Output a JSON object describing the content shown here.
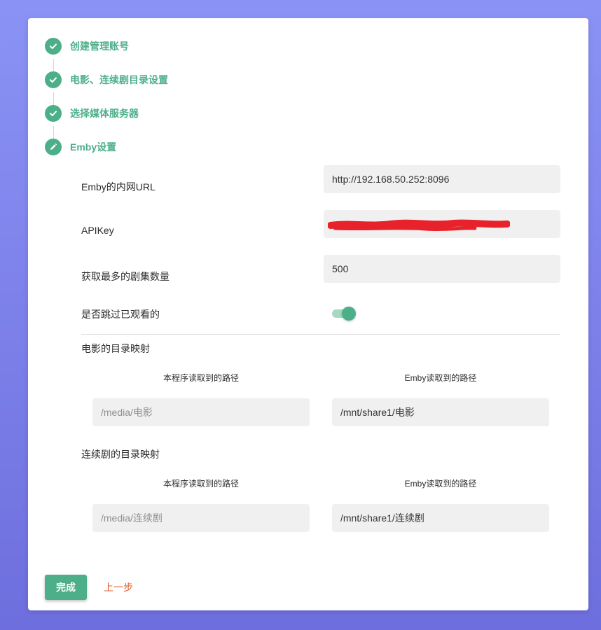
{
  "steps": [
    {
      "label": "创建管理账号",
      "icon": "check-icon"
    },
    {
      "label": "电影、连续剧目录设置",
      "icon": "check-icon"
    },
    {
      "label": "选择媒体服务器",
      "icon": "check-icon"
    },
    {
      "label": "Emby设置",
      "icon": "pencil-icon"
    }
  ],
  "form": {
    "url_label": "Emby的内网URL",
    "url_value": "http://192.168.50.252:8096",
    "apikey_label": "APIKey",
    "apikey_value": "",
    "max_label": "获取最多的剧集数量",
    "max_value": "500",
    "skip_label": "是否跳过已观看的",
    "skip_enabled": true
  },
  "movie_mapping": {
    "title": "电影的目录映射",
    "col_local": "本程序读取到的路径",
    "col_emby": "Emby读取到的路径",
    "local_path": "/media/电影",
    "emby_path": "/mnt/share1/电影"
  },
  "series_mapping": {
    "title": "连续剧的目录映射",
    "col_local": "本程序读取到的路径",
    "col_emby": "Emby读取到的路径",
    "local_path": "/media/连续剧",
    "emby_path": "/mnt/share1/连续剧"
  },
  "buttons": {
    "done": "完成",
    "prev": "上一步"
  },
  "colors": {
    "accent": "#4caf8a",
    "link": "#e05a2b",
    "redaction": "#e8222a"
  }
}
